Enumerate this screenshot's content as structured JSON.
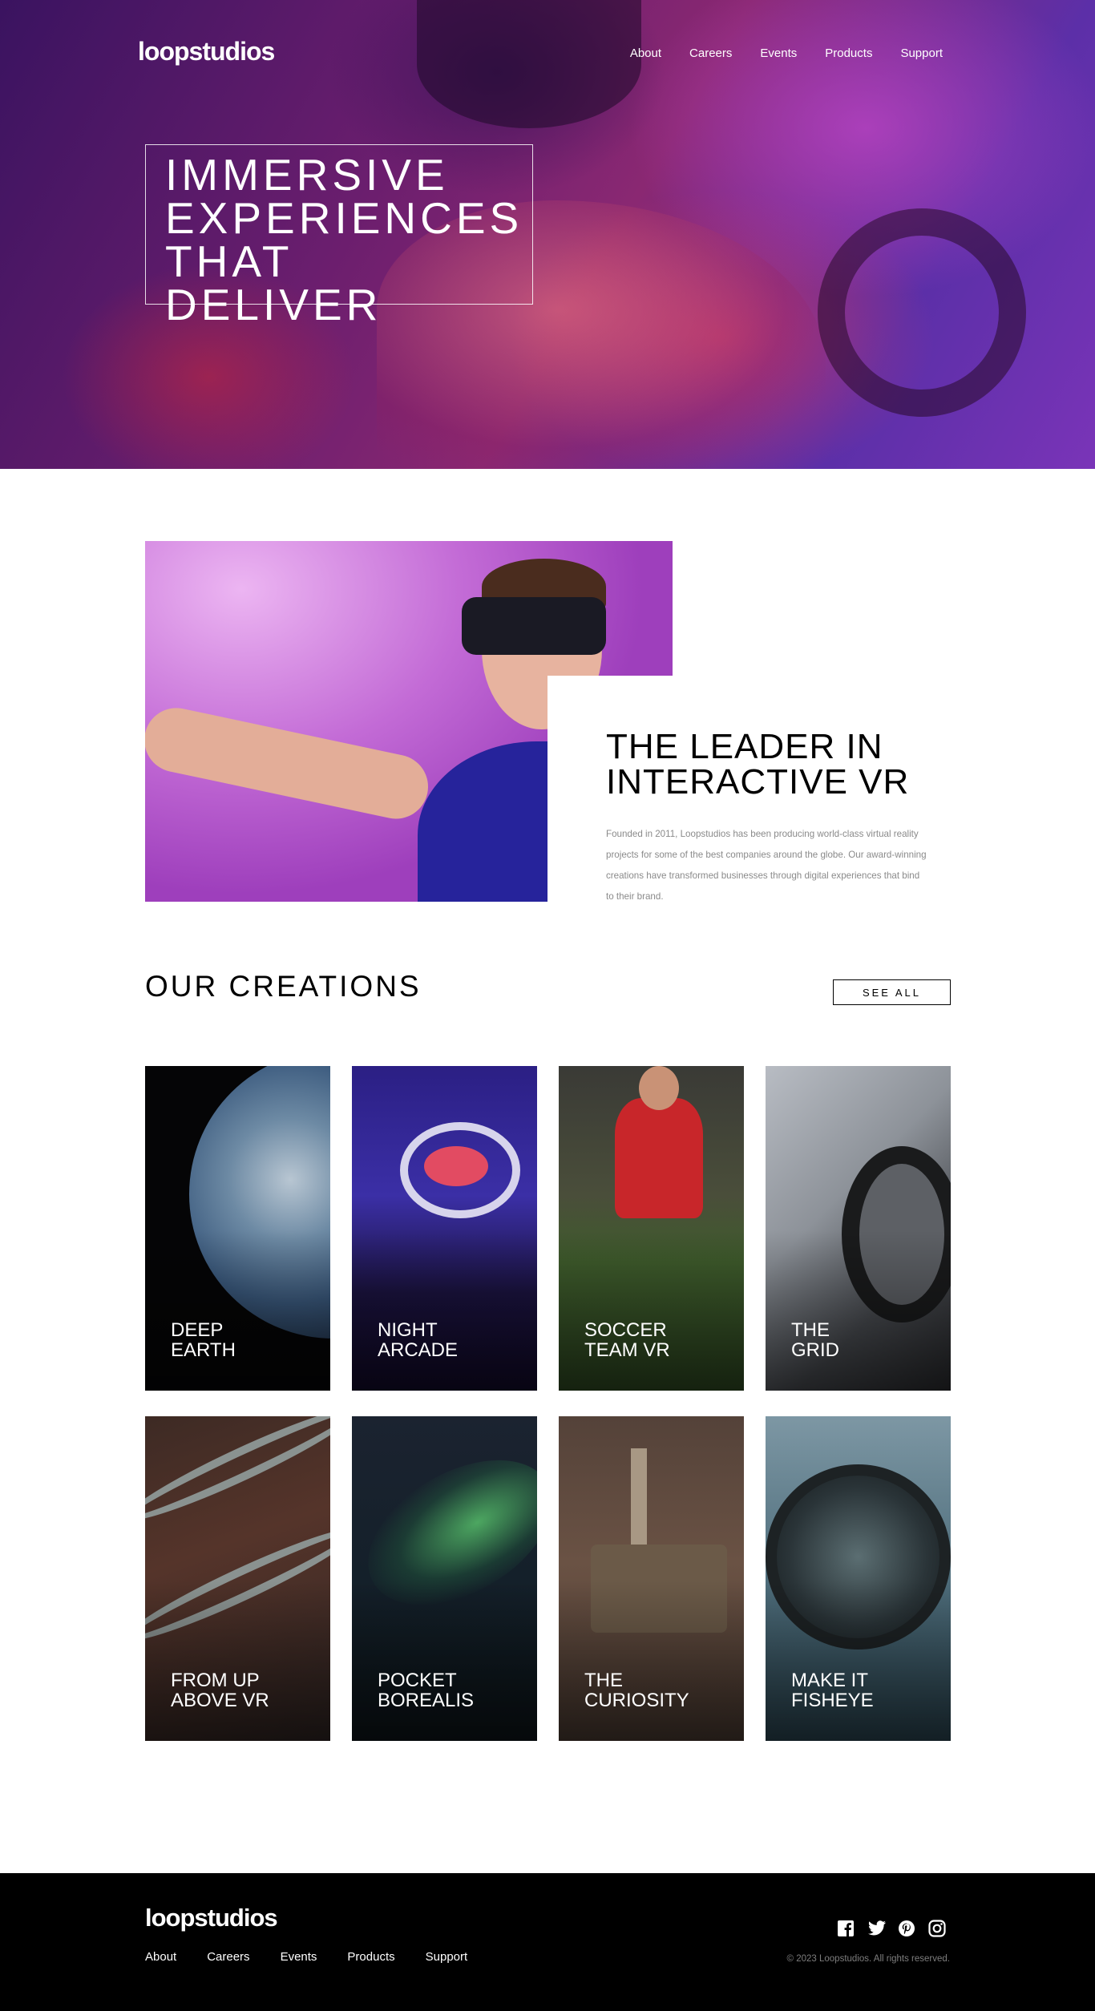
{
  "brand": {
    "logo_text": "loopstudios"
  },
  "nav": {
    "items": [
      "About",
      "Careers",
      "Events",
      "Products",
      "Support"
    ]
  },
  "hero": {
    "headline_lines": [
      "IMMERSIVE",
      "EXPERIENCES",
      "THAT DELIVER"
    ]
  },
  "interactive": {
    "title_lines": [
      "THE LEADER IN",
      "INTERACTIVE VR"
    ],
    "body": "Founded in 2011, Loopstudios has been producing world-class virtual reality projects for some of the best companies around the globe. Our award-winning creations have transformed businesses through digital experiences that bind to their brand."
  },
  "creations": {
    "title": "OUR CREATIONS",
    "see_all_label": "SEE ALL",
    "cards": [
      {
        "lines": [
          "DEEP",
          "EARTH"
        ]
      },
      {
        "lines": [
          "NIGHT",
          "ARCADE"
        ]
      },
      {
        "lines": [
          "SOCCER",
          "TEAM VR"
        ]
      },
      {
        "lines": [
          "THE",
          "GRID"
        ]
      },
      {
        "lines": [
          "FROM UP",
          "ABOVE VR"
        ]
      },
      {
        "lines": [
          "POCKET",
          "BOREALIS"
        ]
      },
      {
        "lines": [
          "THE",
          "CURIOSITY"
        ]
      },
      {
        "lines": [
          "MAKE IT",
          "FISHEYE"
        ]
      }
    ]
  },
  "footer": {
    "logo_text": "loopstudios",
    "copyright": "© 2023 Loopstudios. All rights reserved.",
    "social_icons": [
      "facebook-icon",
      "twitter-icon",
      "pinterest-icon",
      "instagram-icon"
    ]
  }
}
